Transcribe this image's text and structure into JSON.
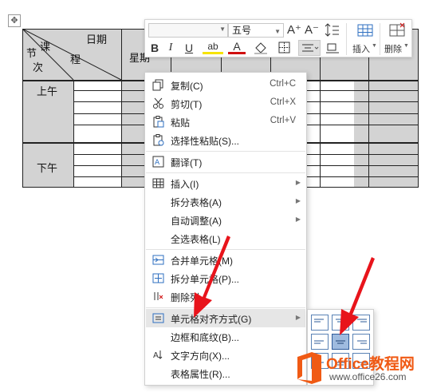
{
  "table": {
    "header_date": "日期",
    "header_ke": "课",
    "header_cheng": "程",
    "header_jie": "节",
    "header_ci": "次",
    "weekday_col": "星期",
    "period_morning": "上午",
    "period_afternoon": "下午"
  },
  "toolbar": {
    "font_name": "",
    "font_size": "五号",
    "bold": "B",
    "italic": "I",
    "underline": "U",
    "highlight": "ab",
    "font_color": "A",
    "grow_font": "A⁺",
    "shrink_font": "A⁻",
    "insert_label": "插入",
    "delete_label": "删除"
  },
  "menu": {
    "items": [
      {
        "label": "复制(C)",
        "shortcut": "Ctrl+C",
        "icon": "copy-icon"
      },
      {
        "label": "剪切(T)",
        "shortcut": "Ctrl+X",
        "icon": "scissors-icon"
      },
      {
        "label": "粘贴",
        "shortcut": "Ctrl+V",
        "icon": "paste-icon"
      },
      {
        "label": "选择性粘贴(S)...",
        "icon": "paste-special-icon"
      },
      {
        "label": "翻译(T)",
        "icon": "translate-icon"
      },
      {
        "label": "插入(I)",
        "icon": "table-insert-icon",
        "submenu": true
      },
      {
        "label": "拆分表格(A)",
        "submenu": true
      },
      {
        "label": "自动调整(A)",
        "submenu": true
      },
      {
        "label": "全选表格(L)"
      },
      {
        "label": "合并单元格(M)",
        "icon": "merge-cells-icon"
      },
      {
        "label": "拆分单元格(P)...",
        "icon": "split-cells-icon"
      },
      {
        "label": "删除列",
        "icon": "delete-column-icon"
      },
      {
        "label": "单元格对齐方式(G)",
        "icon": "cell-align-icon",
        "submenu": true,
        "highlighted": true
      },
      {
        "label": "边框和底纹(B)..."
      },
      {
        "label": "文字方向(X)...",
        "icon": "text-direction-icon"
      },
      {
        "label": "表格属性(R)..."
      }
    ]
  },
  "watermark": {
    "title": "Office教程网",
    "url": "www.office26.com"
  },
  "colors": {
    "table_shade": "#d3d3d3",
    "menu_hover": "#e6e6e6",
    "align_selected": "#9fbbdf",
    "arrow_red": "#e8141b",
    "brand_orange": "#f05a14"
  }
}
